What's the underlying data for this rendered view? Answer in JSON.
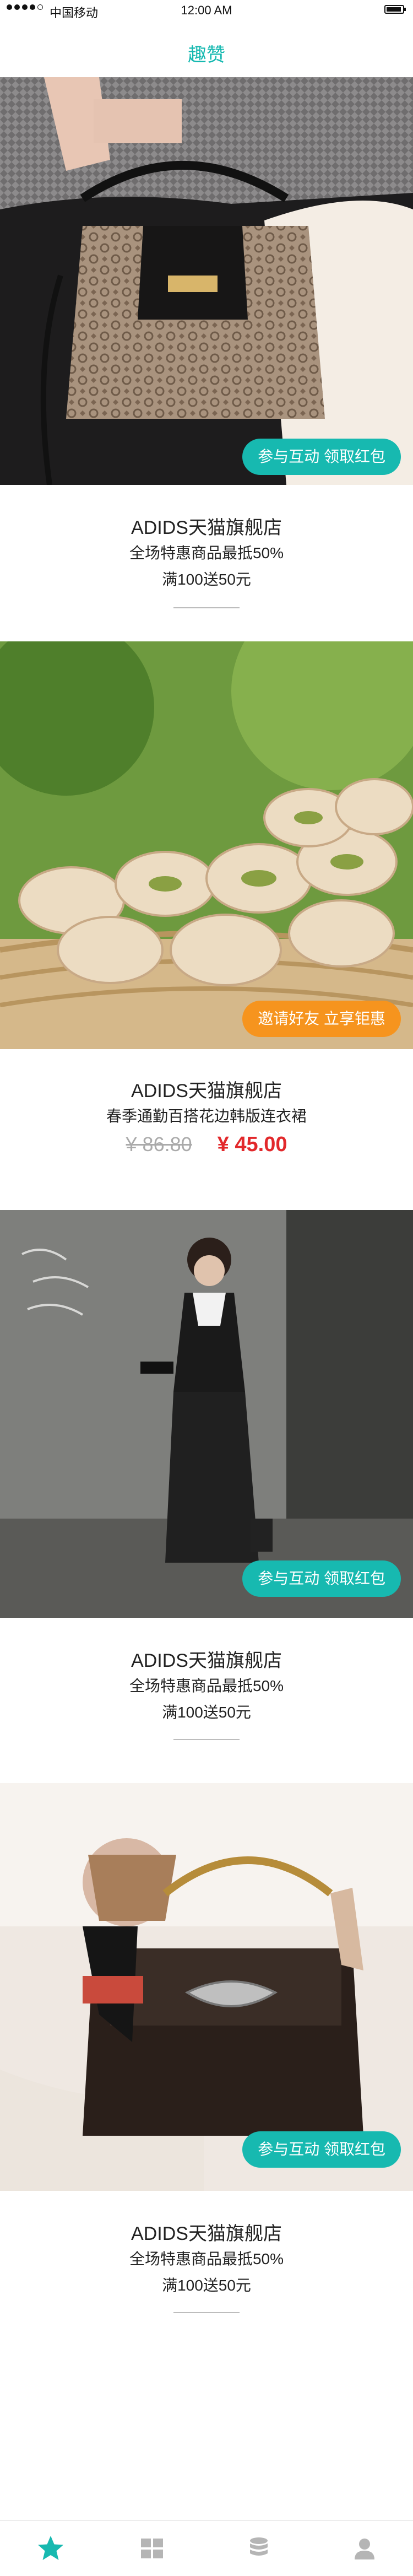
{
  "status_bar": {
    "carrier": "中国移动",
    "time": "12:00 AM"
  },
  "header": {
    "title": "趣赞"
  },
  "cards": [
    {
      "pill": "参与互动 领取红包",
      "title": "ADIDS天猫旗舰店",
      "line1": "全场特惠商品最抵50%",
      "line2": "满100送50元"
    },
    {
      "pill": "邀请好友 立享钜惠",
      "title": "ADIDS天猫旗舰店",
      "subtitle": "春季通勤百搭花边韩版连衣裙",
      "old_price": "¥ 86.80",
      "new_price": "¥ 45.00"
    },
    {
      "pill": "参与互动 领取红包",
      "title": "ADIDS天猫旗舰店",
      "line1": "全场特惠商品最抵50%",
      "line2": "满100送50元"
    },
    {
      "pill": "参与互动 领取红包",
      "title": "ADIDS天猫旗舰店",
      "line1": "全场特惠商品最抵50%",
      "line2": "满100送50元"
    }
  ],
  "tab_bar": {
    "items": [
      {
        "icon": "star-icon",
        "active": true
      },
      {
        "icon": "grid-icon",
        "active": false
      },
      {
        "icon": "database-icon",
        "active": false
      },
      {
        "icon": "user-icon",
        "active": false
      }
    ]
  },
  "colors": {
    "accent": "#17b9b0",
    "orange": "#f6941e",
    "price_red": "#e2282b"
  }
}
